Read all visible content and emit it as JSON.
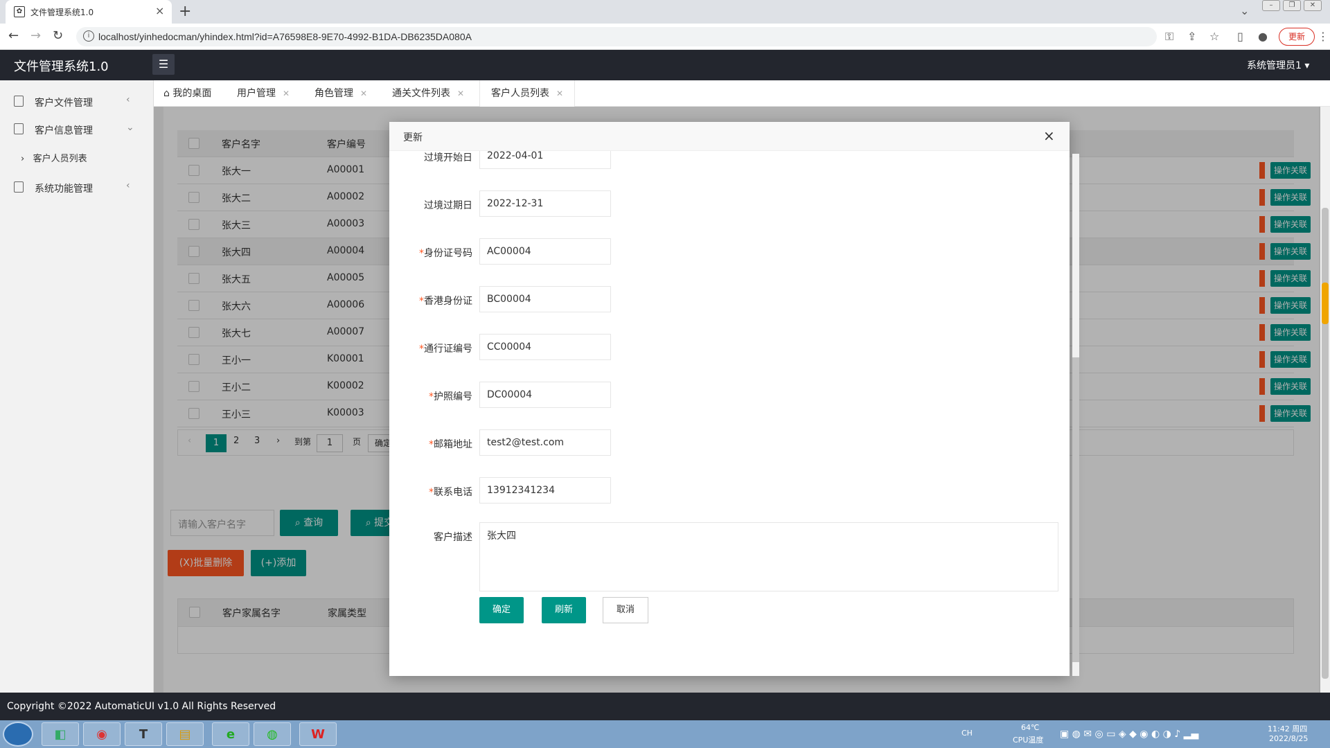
{
  "browser": {
    "tab_title": "文件管理系统1.0",
    "url": "localhost/yinhedocman/yhindex.html?id=A76598E8-9E70-4992-B1DA-DB6235DA080A",
    "update_label": "更新"
  },
  "app": {
    "title": "文件管理系统1.0",
    "user": "系统管理员1"
  },
  "sidebar": {
    "items": [
      {
        "label": "客户文件管理"
      },
      {
        "label": "客户信息管理"
      },
      {
        "label": "系统功能管理"
      }
    ],
    "sub_item": "客户人员列表"
  },
  "page_tabs": [
    {
      "label": "我的桌面"
    },
    {
      "label": "用户管理"
    },
    {
      "label": "角色管理"
    },
    {
      "label": "通关文件列表"
    },
    {
      "label": "客户人员列表"
    }
  ],
  "table": {
    "headers": [
      "客户名字",
      "客户编号"
    ],
    "rows": [
      {
        "name": "张大一",
        "code": "A00001"
      },
      {
        "name": "张大二",
        "code": "A00002"
      },
      {
        "name": "张大三",
        "code": "A00003"
      },
      {
        "name": "张大四",
        "code": "A00004"
      },
      {
        "name": "张大五",
        "code": "A00005"
      },
      {
        "name": "张大六",
        "code": "A00006"
      },
      {
        "name": "张大七",
        "code": "A00007"
      },
      {
        "name": "王小一",
        "code": "K00001"
      },
      {
        "name": "王小二",
        "code": "K00002"
      },
      {
        "name": "王小三",
        "code": "K00003"
      }
    ],
    "op_label": "操作关联"
  },
  "pager": {
    "pages": [
      "1",
      "2",
      "3"
    ],
    "goto_label": "到第",
    "goto_value": "1",
    "page_label": "页",
    "confirm": "确定"
  },
  "search": {
    "placeholder": "请输入客户名字",
    "query_label": "查询",
    "submit_label": "提交"
  },
  "actions": {
    "batch_delete": "(X)批量删除",
    "add": "(+)添加"
  },
  "table2": {
    "headers": [
      "客户家属名字",
      "家属类型"
    ]
  },
  "footer": "Copyright ©2022 AutomaticUI v1.0 All Rights Reserved",
  "modal": {
    "title": "更新",
    "fields": [
      {
        "label": "过境开始日",
        "value": "2022-04-01",
        "required": false
      },
      {
        "label": "过境过期日",
        "value": "2022-12-31",
        "required": false
      },
      {
        "label": "身份证号码",
        "value": "AC00004",
        "required": true
      },
      {
        "label": "香港身份证",
        "value": "BC00004",
        "required": true
      },
      {
        "label": "通行证编号",
        "value": "CC00004",
        "required": true
      },
      {
        "label": "护照编号",
        "value": "DC00004",
        "required": true
      },
      {
        "label": "邮箱地址",
        "value": "test2@test.com",
        "required": true
      },
      {
        "label": "联系电话",
        "value": "13912341234",
        "required": true
      }
    ],
    "desc_label": "客户描述",
    "desc_value": "张大四",
    "btn_confirm": "确定",
    "btn_refresh": "刷新",
    "btn_cancel": "取消",
    "required_mark": "*"
  },
  "taskbar": {
    "lang": "CH",
    "temp": "64℃",
    "temp_label": "CPU温度",
    "time": "11:42 周四",
    "date": "2022/8/25"
  },
  "colors": {
    "accent": "#009688",
    "danger": "#ff5722",
    "topbar": "#23262e"
  }
}
